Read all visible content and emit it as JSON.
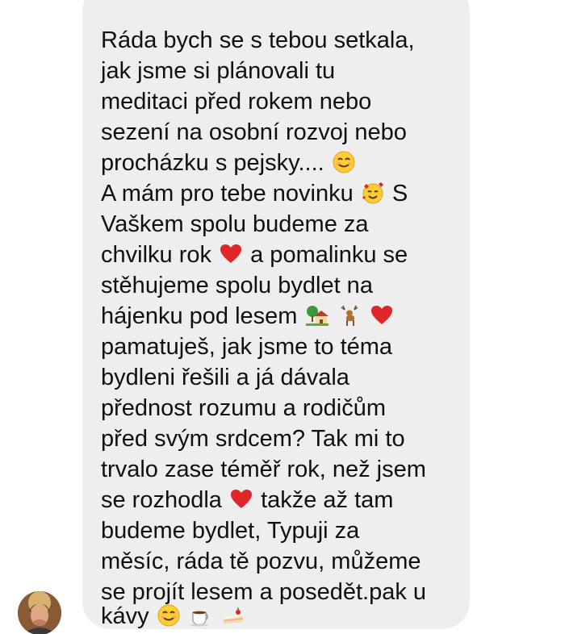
{
  "message": {
    "lines": [
      "Ráda bych se s tebou setkala,",
      "jak jsme si plánovali tu",
      "meditaci před rokem nebo",
      "sezení na osobní rozvoj nebo",
      "procházku s pejsky....",
      "A mám pro tebe novinku",
      "S",
      "Vaškem spolu budeme za",
      "chvilku rok",
      "a pomalinku se",
      "stěhujeme spolu bydlet na",
      "hájenku pod lesem",
      "pamatuješ, jak jsme to téma",
      "bydleni řešili a já dávala",
      "přednost rozumu a rodičům",
      "před svým srdcem? Tak mi to",
      "trvalo zase téměř rok, než jsem",
      "se rozhodla",
      "takže až tam",
      "budeme bydlet, Typuji za",
      "měsíc, ráda tě pozvu, můžeme",
      "se projít lesem a posedět.pak u",
      "kávy"
    ],
    "emojis": {
      "smile": "smiling-face-emoji",
      "hearts_face": "smiling-face-with-hearts-emoji",
      "heart": "red-heart-emoji",
      "house": "house-with-garden-emoji",
      "deer": "deer-emoji",
      "coffee": "hot-beverage-emoji",
      "cake": "shortcake-emoji"
    }
  },
  "sender": {
    "avatar": "contact-avatar"
  },
  "colors": {
    "bubble": "#eeeeee",
    "text": "#101010",
    "heart": "#e0262b"
  }
}
